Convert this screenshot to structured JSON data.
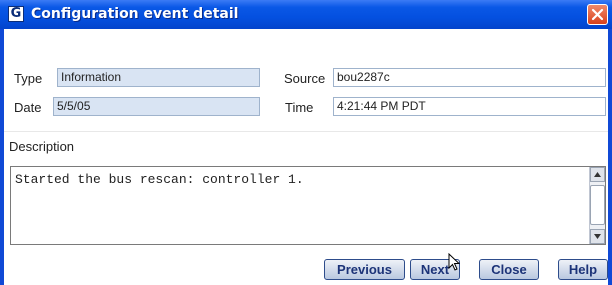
{
  "window": {
    "title": "Configuration event detail",
    "app_icon": "G",
    "close_icon": "close-icon"
  },
  "fields": {
    "type_label": "Type",
    "type_value": "Information",
    "date_label": "Date",
    "date_value": "5/5/05",
    "source_label": "Source",
    "source_value": "bou2287c",
    "time_label": "Time",
    "time_value": "4:21:44 PM PDT"
  },
  "description": {
    "label": "Description",
    "text": "Started the bus rescan: controller 1."
  },
  "buttons": {
    "previous": "Previous",
    "next": "Next",
    "close": "Close",
    "help": "Help"
  },
  "colors": {
    "title_bar": "#0450e0",
    "readonly_field": "#d9e4f3",
    "button_text": "#1c3378"
  }
}
